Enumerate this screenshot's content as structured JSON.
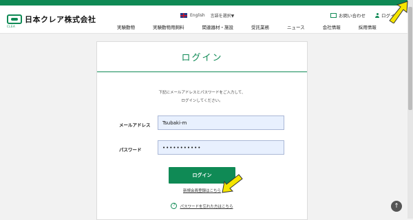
{
  "brand": {
    "name": "日本クレア株式会社",
    "sub": "CLEA"
  },
  "lang": {
    "current": "English",
    "select": "言語を選択▼"
  },
  "util": {
    "contact": "お問い合わせ",
    "login": "ログイン"
  },
  "nav": {
    "items": [
      {
        "label": "実験動物"
      },
      {
        "label": "実験動物用飼料"
      },
      {
        "label": "関連器材・施設"
      },
      {
        "label": "受託業務"
      },
      {
        "label": "ニュース"
      },
      {
        "label": "会社情報"
      },
      {
        "label": "採用情報"
      }
    ]
  },
  "login": {
    "title": "ログイン",
    "instruction_line1": "下記にメールアドレスとパスワードをご入力して、",
    "instruction_line2": "ログインしてください。",
    "email_label": "メールアドレス",
    "email_value": "Tsubaki-m",
    "password_label": "パスワード",
    "password_value": "•••••••••••",
    "button_label": "ログイン",
    "register_link": "新規会員登録はこちら",
    "forgot_link": "パスワードを忘れた方はこちら"
  },
  "colors": {
    "brand_green": "#0f8a55",
    "highlight_yellow": "#f5e500"
  },
  "icons": {
    "mail": "mail-icon",
    "user": "user-icon",
    "help": "help-icon",
    "scroll_top": "arrow-up-icon"
  }
}
